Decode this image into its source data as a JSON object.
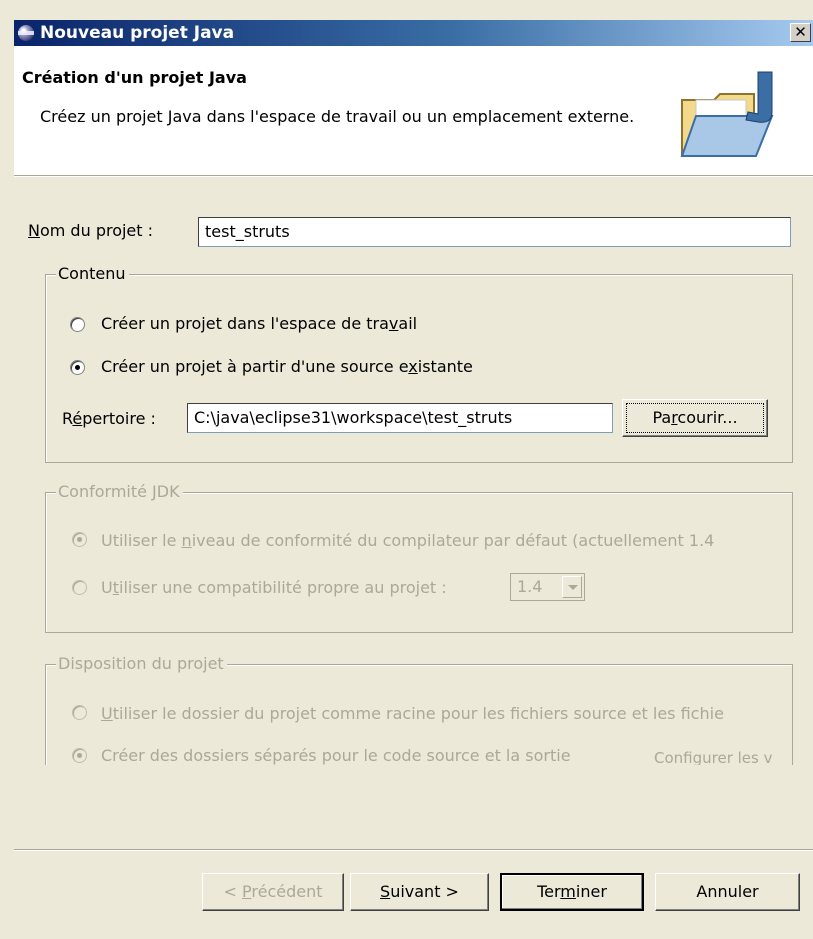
{
  "window": {
    "title": "Nouveau projet Java",
    "close_glyph": "✕"
  },
  "banner": {
    "heading": "Création d'un projet Java",
    "description": "Créez un projet Java dans l'espace de travail ou un emplacement externe.",
    "icon": "java-folder-icon"
  },
  "project_name": {
    "label_mnemonic": "N",
    "label_rest": "om du projet :",
    "value": "test_struts"
  },
  "contents": {
    "title": "Contenu",
    "option_workspace": {
      "pre": "Créer un projet dans l'espace de tra",
      "mnemonic": "v",
      "post": "ail",
      "checked": false
    },
    "option_existing": {
      "pre": "Créer un projet à partir d'une source e",
      "mnemonic": "x",
      "post": "istante",
      "checked": true
    },
    "directory_label_pre": "R",
    "directory_label_mnemonic": "é",
    "directory_label_post": "pertoire :",
    "directory_value": "C:\\java\\eclipse31\\workspace\\test_struts",
    "browse_pre": "Pa",
    "browse_mnemonic": "r",
    "browse_post": "courir..."
  },
  "jdk": {
    "title": "Conformité JDK",
    "option_default": {
      "pre": "Utiliser le ",
      "mnemonic": "n",
      "post": "iveau de conformité du compilateur par défaut (actuellement 1.4",
      "checked": true
    },
    "option_project": {
      "pre": "U",
      "mnemonic": "t",
      "post": "iliser une compatibilité propre au projet :",
      "checked": false
    },
    "level_value": "1.4"
  },
  "layout": {
    "title": "Disposition du projet",
    "option_root": {
      "mnemonic": "U",
      "post": "tiliser le dossier du projet comme racine pour les fichiers source et les fichie",
      "checked": false
    },
    "option_separate": {
      "text": "Créer des dossiers séparés pour le code source et la sortie",
      "checked": true
    },
    "configure_link": "Configurer les v"
  },
  "buttons": {
    "back_pre": "< ",
    "back_mnemonic": "P",
    "back_post": "récédent",
    "next_mnemonic": "S",
    "next_post": "uivant >",
    "finish_pre": "Ter",
    "finish_mnemonic": "m",
    "finish_post": "iner",
    "cancel": "Annuler"
  }
}
